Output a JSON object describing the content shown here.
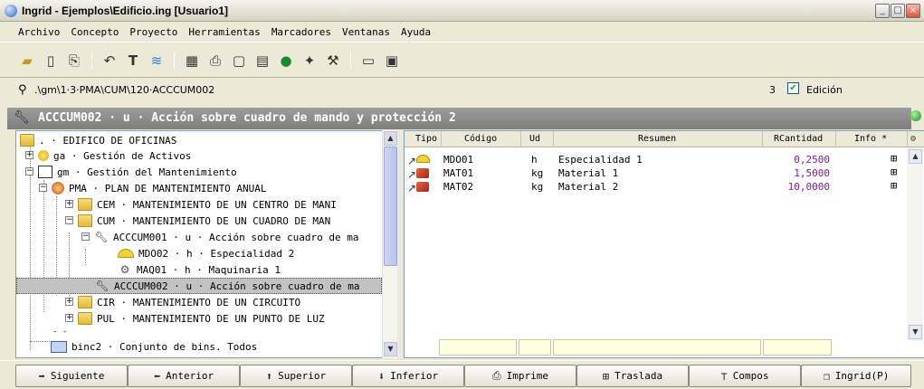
{
  "window": {
    "title": "Ingrid - Ejemplos\\Edificio.ing  [Usuario1]"
  },
  "menu": [
    "Archivo",
    "Concepto",
    "Proyecto",
    "Herramientas",
    "Marcadores",
    "Ventanas",
    "Ayuda"
  ],
  "pathbar": {
    "path": ".\\gm\\1·3·PMA\\CUM\\120·ACCCUM002",
    "count": "3",
    "checkbox_label": "Edición",
    "checked": true
  },
  "header": {
    "text": "ACCCUM002 · u · Acción sobre cuadro de mando y protección 2"
  },
  "tree": [
    {
      "text": ". · EDIFICO DE OFICINAS"
    },
    {
      "text": "ga · Gestión de Activos"
    },
    {
      "text": "gm · Gestión del Mantenimiento"
    },
    {
      "text": "PMA · PLAN DE MANTENIMIENTO ANUAL"
    },
    {
      "text": "CEM · MANTENIMIENTO DE UN CENTRO DE MANI"
    },
    {
      "text": "CUM · MANTENIMIENTO DE UN CUADRO DE MAN"
    },
    {
      "text": "ACCCUM001 · u · Acción sobre cuadro de ma"
    },
    {
      "text": "MDO02 · h · Especialidad 2"
    },
    {
      "text": "MAQ01 · h · Maquinaria 1"
    },
    {
      "text": "ACCCUM002 · u · Acción sobre cuadro de ma"
    },
    {
      "text": "CIR · MANTENIMIENTO DE UN CIRCUITO"
    },
    {
      "text": "PUL · MANTENIMIENTO DE UN PUNTO DE LUZ"
    },
    {
      "text": "- -"
    },
    {
      "text": "binc2 · Conjunto de bins. Todos"
    }
  ],
  "grid": {
    "headers": {
      "tipo": "Tipo",
      "codigo": "Código",
      "ud": "Ud",
      "resumen": "Resumen",
      "rcantidad": "RCantidad",
      "info": "Info *"
    },
    "rows": [
      {
        "codigo": "MDO01",
        "ud": "h",
        "resumen": "Especialidad 1",
        "rcantidad": "0,2500"
      },
      {
        "codigo": "MAT01",
        "ud": "kg",
        "resumen": "Material 1",
        "rcantidad": "1,5000"
      },
      {
        "codigo": "MAT02",
        "ud": "kg",
        "resumen": "Material 2",
        "rcantidad": "10,0000"
      }
    ]
  },
  "buttons": {
    "siguiente": "Siguiente",
    "anterior": "Anterior",
    "superior": "Superior",
    "inferior": "Inferior",
    "imprime": "Imprime",
    "traslada": "Traslada",
    "compos": "Compos",
    "ingrid": "Ingrid(P)"
  }
}
